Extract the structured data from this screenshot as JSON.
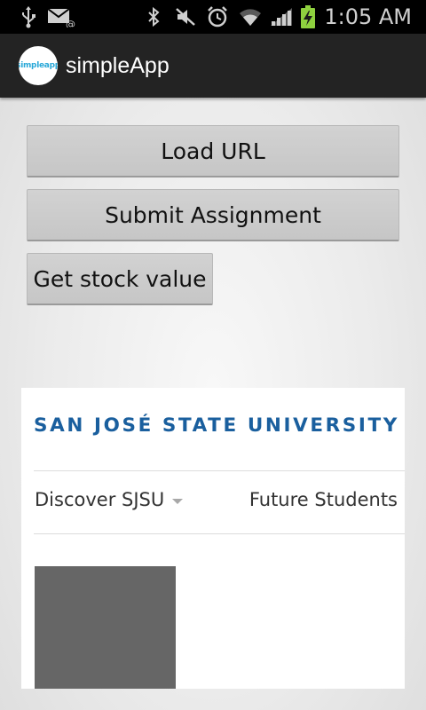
{
  "status_bar": {
    "time": "1:05 AM",
    "icons": [
      "usb-icon",
      "gmail-icon",
      "bluetooth-icon",
      "mute-icon",
      "alarm-icon",
      "wifi-icon",
      "signal-icon",
      "battery-charging-icon"
    ]
  },
  "action_bar": {
    "app_icon_text": "simpleapp",
    "title": "simpleApp"
  },
  "buttons": {
    "load_url": "Load URL",
    "submit_assignment": "Submit Assignment",
    "get_stock_value": "Get stock value"
  },
  "webview": {
    "logo_text": "SAN JOSÉ STATE UNIVERSITY",
    "nav": {
      "discover": "Discover SJSU",
      "future_students": "Future Students"
    }
  },
  "colors": {
    "status_bar": "#000000",
    "action_bar": "#232323",
    "button": "#cacaca",
    "sjsu_blue": "#1a5f9e",
    "battery_green": "#8fd13f"
  }
}
